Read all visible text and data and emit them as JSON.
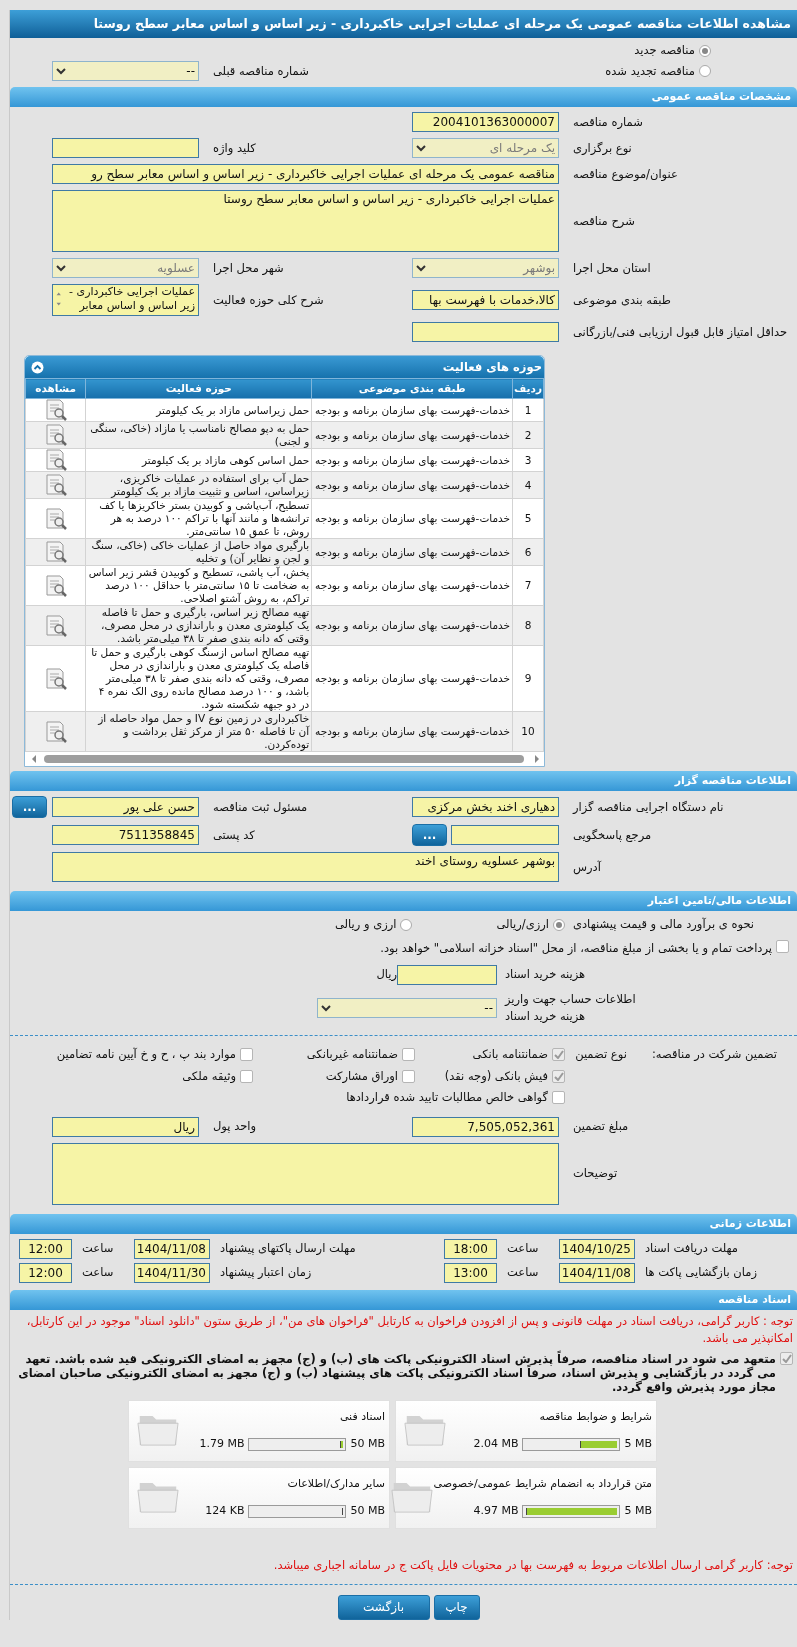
{
  "title": "مشاهده اطلاعات مناقصه عمومی یک مرحله ای عملیات اجرایی خاکبرداری - زیر اساس و اساس معابر سطح روستا",
  "tender_kind": [
    {
      "label": "مناقصه جدید",
      "selected": true
    },
    {
      "label": "مناقصه تجدید شده",
      "selected": false
    }
  ],
  "previous_tender": {
    "label": "شماره مناقصه قبلی",
    "value": "--",
    "disabled": false
  },
  "general": {
    "header": "مشخصات مناقصه عمومی",
    "rows": [
      [
        {
          "kind": "input",
          "label": "شماره مناقصه",
          "value": "2004101363000007"
        }
      ],
      [
        {
          "kind": "select",
          "label": "نوع برگزاری",
          "value": "یک مرحله ای",
          "disabled": true
        },
        {
          "kind": "input",
          "label": "کلید واژه"
        }
      ],
      [
        {
          "kind": "wide_input",
          "label": "عنوان/موضوع مناقصه",
          "value": "مناقصه عمومی یک مرحله ای عملیات اجرایی  خاکبرداری - زیر اساس و اساس معابر سطح رو"
        }
      ],
      [
        {
          "kind": "wide_textarea",
          "label": "شرح مناقصه",
          "value": "عملیات اجرایی  خاکبرداری - زیر اساس و اساس معابر سطح روستا"
        }
      ],
      [
        {
          "kind": "select",
          "label": "استان محل اجرا",
          "value": "بوشهر",
          "disabled": true
        },
        {
          "kind": "select",
          "label": "شهر محل اجرا",
          "value": "عسلویه",
          "disabled": true
        }
      ],
      [
        {
          "kind": "input",
          "label": "طبقه بندی موضوعی",
          "value": "کالا،خدمات با فهرست بها"
        },
        {
          "kind": "listbox",
          "label": "شرح کلی حوزه فعالیت",
          "value": "عملیات اجرایی  خاکبرداری - زیر اساس و اساس معابر"
        }
      ],
      [
        {
          "kind": "input",
          "label": "حداقل امتیاز قابل قبول ارزیابی فنی/بازرگانی"
        }
      ]
    ]
  },
  "activities": {
    "title": "حوزه های فعالیت",
    "columns": [
      "ردیف",
      "طبقه بندی موضوعی",
      "حوزه فعالیت",
      "مشاهده"
    ],
    "rows": [
      {
        "index": "1",
        "category": "خدمات-فهرست بهای سازمان برنامه و بودجه",
        "activity": "حمل زیراساس مازاد بر یک کیلومتر"
      },
      {
        "index": "2",
        "category": "خدمات-فهرست بهای سازمان برنامه و بودجه",
        "activity": "حمل به دپو مصالح نامناسب یا مازاد (خاکی، سنگی و لجنی)"
      },
      {
        "index": "3",
        "category": "خدمات-فهرست بهای سازمان برنامه و بودجه",
        "activity": "حمل اساس کوهی مازاد بر یک کیلومتر"
      },
      {
        "index": "4",
        "category": "خدمات-فهرست بهای سازمان برنامه و بودجه",
        "activity": "حمل آب برای استفاده در عملیات خاکریزی، زیراساس، اساس و تثبیت مازاد بر یک کیلومتر"
      },
      {
        "index": "5",
        "category": "خدمات-فهرست بهای سازمان برنامه و بودجه",
        "activity": "تسطیح، آب‌پاشی و کوبیدن بستر خاکریزها یا کف ترانشه‌ها و مانند آنها با تراکم ۱۰۰ درصد به هر روش، تا عمق ۱۵ سانتی‌متر."
      },
      {
        "index": "6",
        "category": "خدمات-فهرست بهای سازمان برنامه و بودجه",
        "activity": "بارگیری مواد حاصل از عملیات خاکی (خاکی، سنگ و لجن و نظایر آن) و تخلیه"
      },
      {
        "index": "7",
        "category": "خدمات-فهرست بهای سازمان برنامه و بودجه",
        "activity": "پخش، آب پاشی، تسطیح و کوبیدن قشر زیر اساس به ضخامت تا ۱۵ سانتی‌متر با حداقل ۱۰۰ درصد تراکم، به روش آشتو اصلاحی."
      },
      {
        "index": "8",
        "category": "خدمات-فهرست بهای سازمان برنامه و بودجه",
        "activity": "تهیه مصالح زیر اساس، بارگیری و حمل تا فاصله یک کیلومتری معدن و باراندازی در محل مصرف، وقتی که دانه بندی صفر تا ۳۸ میلی‌متر باشد."
      },
      {
        "index": "9",
        "category": "خدمات-فهرست بهای سازمان برنامه و بودجه",
        "activity": "تهیه مصالح اساس ازسنگ کوهی بارگیری و حمل تا فاصله یک کیلومتری معدن و باراندازی در محل مصرف، وقتی که دانه بندی صفر تا ۳۸ میلی‌متر باشد، و ۱۰۰ درصد مصالح مانده روی الک نمره ۴ در دو جبهه شکسته شود."
      },
      {
        "index": "10",
        "category": "خدمات-فهرست بهای سازمان برنامه و بودجه",
        "activity": "خاکبرداری در زمین نوع IV و حمل مواد حاصله از آن تا فاصله ۵۰ متر از مرکز ثقل برداشت و توده‌کردن."
      }
    ]
  },
  "tenderer": {
    "header": "اطلاعات مناقصه گزار",
    "rows": [
      [
        {
          "kind": "input",
          "label": "نام دستگاه اجرایی مناقصه گزار",
          "value": "دهیاری اخند بخش مرکزی"
        },
        {
          "kind": "input",
          "label": "مسئول ثبت مناقصه",
          "value": "حسن علی پور",
          "button": "..."
        }
      ],
      [
        {
          "kind": "input",
          "label": "مرجع پاسخگویی",
          "button": "..."
        },
        {
          "kind": "input",
          "label": "کد پستی",
          "value": "7511358845"
        }
      ],
      [
        {
          "kind": "memo",
          "label": "آدرس",
          "value": "بوشهر عسلویه روستای اخند"
        }
      ]
    ]
  },
  "finance": {
    "header": "اطلاعات مالی/تامین اعتبار",
    "estimate_label": "نحوه ی برآورد مالی و قیمت پیشنهادی",
    "estimate_options": [
      {
        "label": "ارزی/ریالی",
        "selected": true
      },
      {
        "label": "ارزی و ریالی",
        "selected": false
      }
    ],
    "treasury": {
      "label": "پرداخت تمام و یا بخشی از مبلغ مناقصه، از محل \"اسناد خزانه اسلامی\" خواهد بود.",
      "checked": false
    },
    "document_cost": {
      "label": "هزینه خرید اسناد",
      "unit": "ریال"
    },
    "account": {
      "label": "اطلاعات حساب جهت واریز هزینه خرید اسناد",
      "value": "--",
      "disabled": false
    }
  },
  "guarantee": {
    "title": "تضمین شرکت در مناقصه:",
    "type_label": "نوع تضمین",
    "options": [
      {
        "label": "ضمانتنامه بانکی",
        "checked": true
      },
      {
        "label": "ضمانتنامه غیربانکی",
        "checked": false
      },
      {
        "label": "موارد بند پ ، ح و خ آیین نامه تضامین",
        "checked": false
      },
      {
        "label": "فیش بانکی (وجه نقد)",
        "checked": true
      },
      {
        "label": "اوراق مشارکت",
        "checked": false
      },
      {
        "label": "وثیقه ملکی",
        "checked": false
      },
      {
        "label": "گواهی خالص مطالبات تایید شده قراردادها",
        "checked": false
      }
    ],
    "rows": [
      [
        {
          "kind": "input",
          "label": "مبلغ تضمین",
          "value": "7,505,052,361"
        },
        {
          "kind": "input",
          "label": "واحد پول",
          "value": "ریال"
        }
      ],
      [
        {
          "kind": "wide_textarea",
          "label": "توضیحات"
        }
      ]
    ]
  },
  "schedule": {
    "header": "اطلاعات زمانی",
    "items": [
      {
        "label": "مهلت دریافت اسناد",
        "date": "1404/10/25",
        "time_label": "ساعت",
        "time": "18:00"
      },
      {
        "label": "مهلت ارسال پاکتهای پیشنهاد",
        "date": "1404/11/08",
        "time_label": "ساعت",
        "time": "12:00"
      },
      {
        "label": "زمان بازگشایی پاکت ها",
        "date": "1404/11/08",
        "time_label": "ساعت",
        "time": "13:00"
      },
      {
        "label": "زمان اعتبار پیشنهاد",
        "date": "1404/11/30",
        "time_label": "ساعت",
        "time": "12:00"
      }
    ]
  },
  "documents": {
    "header": "اسناد مناقصه",
    "notice": "توجه : کاربر گرامی، دریافت اسناد در مهلت قانونی و پس از افزودن فراخوان به کارتابل \"فراخوان های من\"، از طریق ستون \"دانلود اسناد\" موجود در این کارتابل، امکانپذیر می باشد.",
    "commitment": {
      "text": "متعهد می شود در اسناد مناقصه، صرفاً پذیرش اسناد الکترونیکی پاکت های (ب) و (ج) مجهز به امضای الکترونیکی قید شده باشد. تعهد می گردد در بازگشایی و پذیرش اسناد، صرفاً اسناد الکترونیکی پاکت های پیشنهاد (ب) و (ج) مجهز به امضای الکترونیکی صاحبان امضای مجاز مورد پذیرش واقع گردد.",
      "checked": true
    },
    "files": [
      {
        "title": "شرایط و ضوابط مناقصه",
        "size": "2.04 MB",
        "limit": "5 MB",
        "level": 0.408
      },
      {
        "title": "اسناد فنی",
        "size": "1.79 MB",
        "limit": "50 MB",
        "level": 0.036
      },
      {
        "title": "متن قرارداد به انضمام شرایط عمومی/خصوصی",
        "size": "4.97 MB",
        "limit": "5 MB",
        "level": 0.994
      },
      {
        "title": "سایر مدارک/اطلاعات",
        "size": "124 KB",
        "limit": "50 MB",
        "level": 0.003
      }
    ],
    "footnote": "توجه: کاربر گرامی ارسال اطلاعات مربوط به فهرست بها در محتویات فایل پاکت ج در سامانه اجباری میباشد."
  },
  "buttons": [
    "چاپ",
    "بازگشت"
  ]
}
